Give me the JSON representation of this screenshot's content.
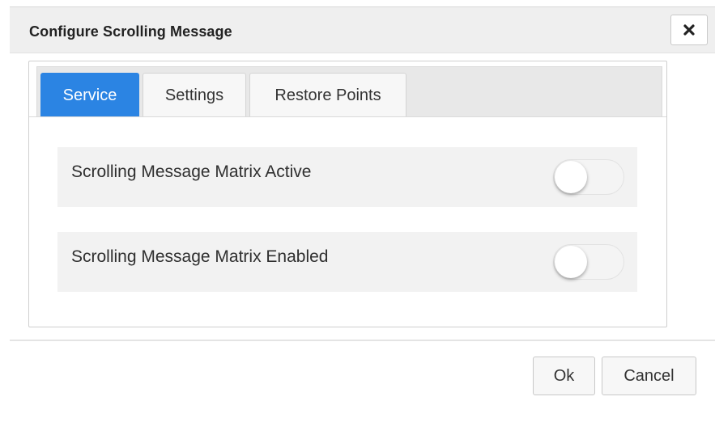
{
  "dialog": {
    "title": "Configure Scrolling Message",
    "close_icon": "close-icon"
  },
  "tabs": [
    {
      "label": "Service",
      "active": true
    },
    {
      "label": "Settings",
      "active": false
    },
    {
      "label": "Restore Points",
      "active": false
    }
  ],
  "service": {
    "settings": [
      {
        "label": "Scrolling Message Matrix Active",
        "enabled": false
      },
      {
        "label": "Scrolling Message Matrix Enabled",
        "enabled": false
      }
    ]
  },
  "footer": {
    "ok_label": "Ok",
    "cancel_label": "Cancel"
  },
  "colors": {
    "active_tab": "#2b84e3",
    "header_bg": "#efefef"
  }
}
